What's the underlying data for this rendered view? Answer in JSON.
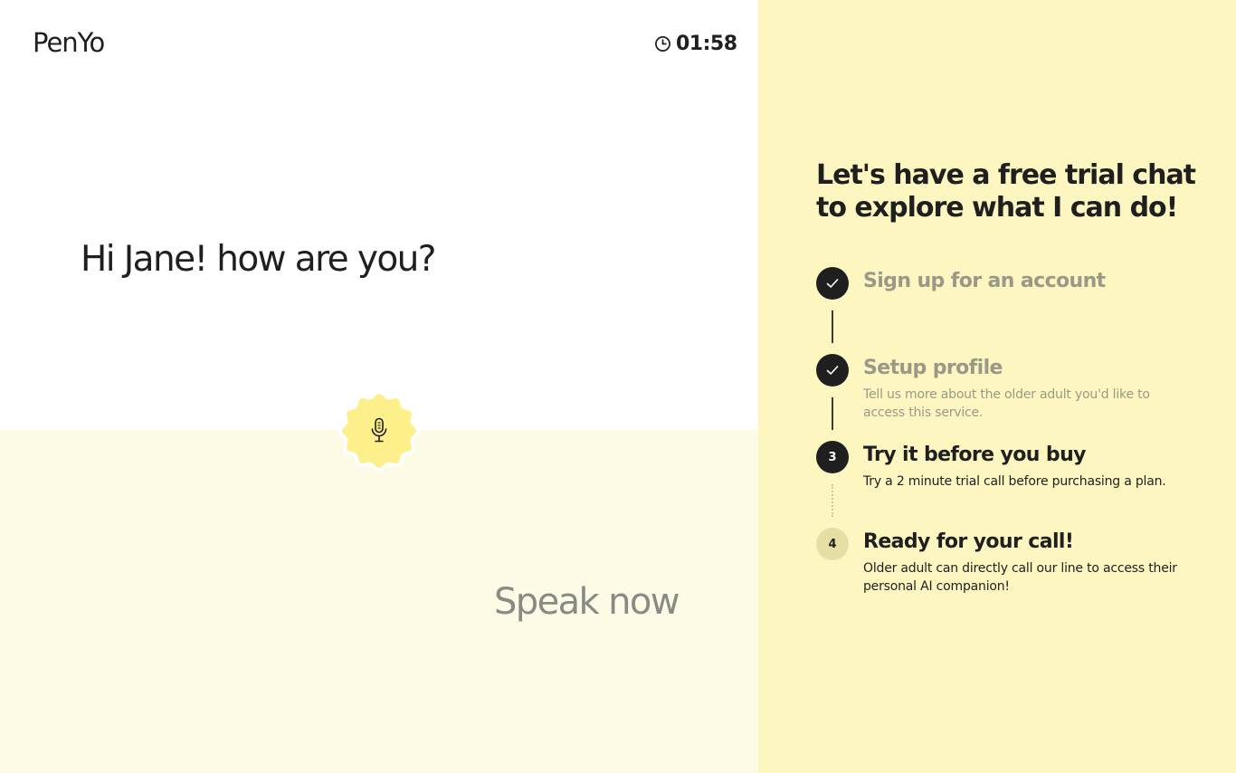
{
  "header": {
    "logo_text": "PenYo",
    "timer": "01:58",
    "timer_icon": "clock-icon"
  },
  "main": {
    "greeting": "Hi Jane! how are you?",
    "mic_icon": "microphone-icon",
    "speak_prompt": "Speak now"
  },
  "sidebar": {
    "title": "Let's have a free trial chat to explore what I can do!",
    "steps": [
      {
        "marker": "check",
        "status": "done",
        "title": "Sign up for an account",
        "desc": ""
      },
      {
        "marker": "check",
        "status": "done",
        "title": "Setup profile",
        "desc": "Tell us more about the older adult you'd like to access this service."
      },
      {
        "marker": "3",
        "status": "current",
        "title": "Try it before you buy",
        "desc": "Try a 2 minute trial call before purchasing a plan."
      },
      {
        "marker": "4",
        "status": "upcoming",
        "title": "Ready for your call!",
        "desc": "Older adult can directly call our line to access their personal AI companion!"
      }
    ]
  },
  "colors": {
    "sidebar_bg": "#fdf6c0",
    "lower_panel_bg": "#fdfae6",
    "mic_badge": "#fdf08a",
    "dark": "#1f1f1f",
    "muted": "#9b9887"
  }
}
